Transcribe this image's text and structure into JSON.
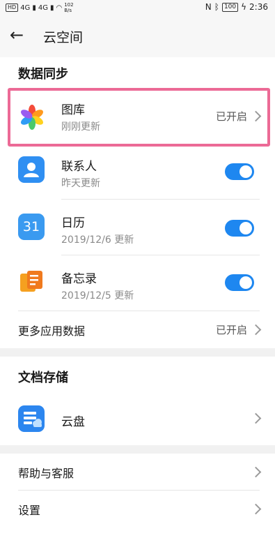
{
  "status_bar": {
    "left_badge": "HD",
    "network_1": "4G",
    "network_2": "4G",
    "speed_value": "102",
    "speed_unit": "B/s",
    "battery": "100",
    "time": "2:36"
  },
  "app_bar": {
    "title": "云空间",
    "back_icon": "arrow-left-icon"
  },
  "sync_section": {
    "title": "数据同步",
    "items": [
      {
        "name": "图库",
        "subtitle": "刚刚更新",
        "status": "已开启",
        "icon": "gallery-pinwheel-icon"
      },
      {
        "name": "联系人",
        "subtitle": "昨天更新",
        "toggle_on": true,
        "icon": "contacts-icon"
      },
      {
        "name": "日历",
        "subtitle": "2019/12/6 更新",
        "toggle_on": true,
        "icon": "calendar-icon",
        "icon_text": "31"
      },
      {
        "name": "备忘录",
        "subtitle": "2019/12/5 更新",
        "toggle_on": true,
        "icon": "notes-icon"
      }
    ],
    "more": {
      "label": "更多应用数据",
      "status": "已开启"
    }
  },
  "docs_section": {
    "title": "文档存储",
    "drive": {
      "label": "云盘",
      "icon": "cloud-drive-icon"
    }
  },
  "misc_section": {
    "help": "帮助与客服",
    "settings": "设置"
  },
  "colors": {
    "toggle_on": "#1e87f0",
    "highlight_border": "#ec6a96",
    "contacts_blue": "#2f8ff2",
    "calendar_blue": "#3a9af0",
    "notes_orange": "#f5a020",
    "drive_blue": "#2c86ef"
  }
}
